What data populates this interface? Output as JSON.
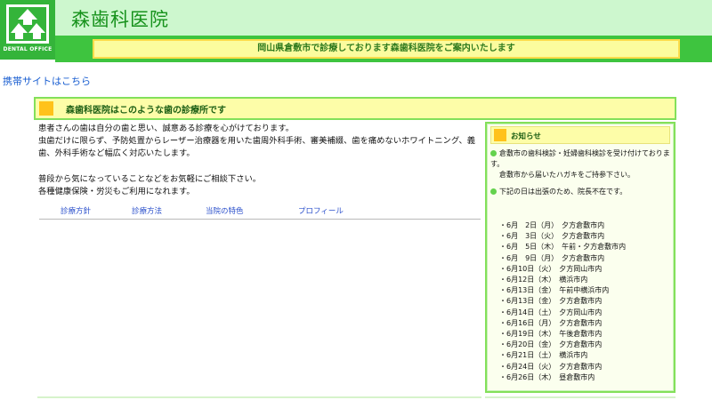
{
  "header": {
    "clinic_name": "森歯科医院",
    "logo_text": "DENTAL OFFICE",
    "tagline": "岡山県倉敷市で診療しております森歯科医院をご案内いたします"
  },
  "mobile_link": "携帯サイトはこちら",
  "section_title": "森歯科医院はこのような歯の診療所です",
  "main": {
    "paragraph1_lines": [
      "患者さんの歯は自分の歯と思い、誠意ある診療を心がけております。",
      "虫歯だけに限らず、予防処置からレーザー治療器を用いた歯周外科手術、審美補綴、歯を痛めないホワイトニング、義",
      "歯、外科手術など幅広く対応いたします。"
    ],
    "paragraph2_lines": [
      "普段から気になっていることなどをお気軽にご相談下さい。",
      "各種健康保険・労災もご利用になれます。"
    ]
  },
  "nav": [
    {
      "label": "診療方針"
    },
    {
      "label": "診療方法"
    },
    {
      "label": "当院の特色"
    },
    {
      "label": "プロフィール"
    }
  ],
  "news": {
    "title": "お知らせ",
    "item1_lines": [
      "倉敷市の歯科検診・妊婦歯科検診を受け付けております。",
      "倉敷市から届いたハガキをご持参下さい。"
    ],
    "item2": "下記の日は出張のため、院長不在です。",
    "schedule": [
      "・6月　2日（月）　夕方倉敷市内",
      "・6月　3日（火）　夕方倉敷市内",
      "・6月　5日（木）　午前・夕方倉敷市内",
      "・6月　9日（月）　夕方倉敷市内",
      "・6月10日（火）　夕方岡山市内",
      "・6月12日（木）　横浜市内",
      "・6月13日（金）　午前中横浜市内",
      "・6月13日（金）　夕方倉敷市内",
      "・6月14日（土）　夕方岡山市内",
      "・6月16日（月）　夕方倉敷市内",
      "・6月19日（木）　午後倉敷市内",
      "・6月20日（金）　夕方倉敷市内",
      "・6月21日（土）　横浜市内",
      "・6月24日（火）　夕方倉敷市内",
      "・6月26日（木）　昼倉敷市内"
    ]
  },
  "colors": {
    "brand_green": "#34b43a",
    "header_light": "#cdf7ce",
    "tagline_yellow": "#fbfc9e",
    "accent_orange": "#ffc21a",
    "link_blue": "#1b5fd1"
  }
}
